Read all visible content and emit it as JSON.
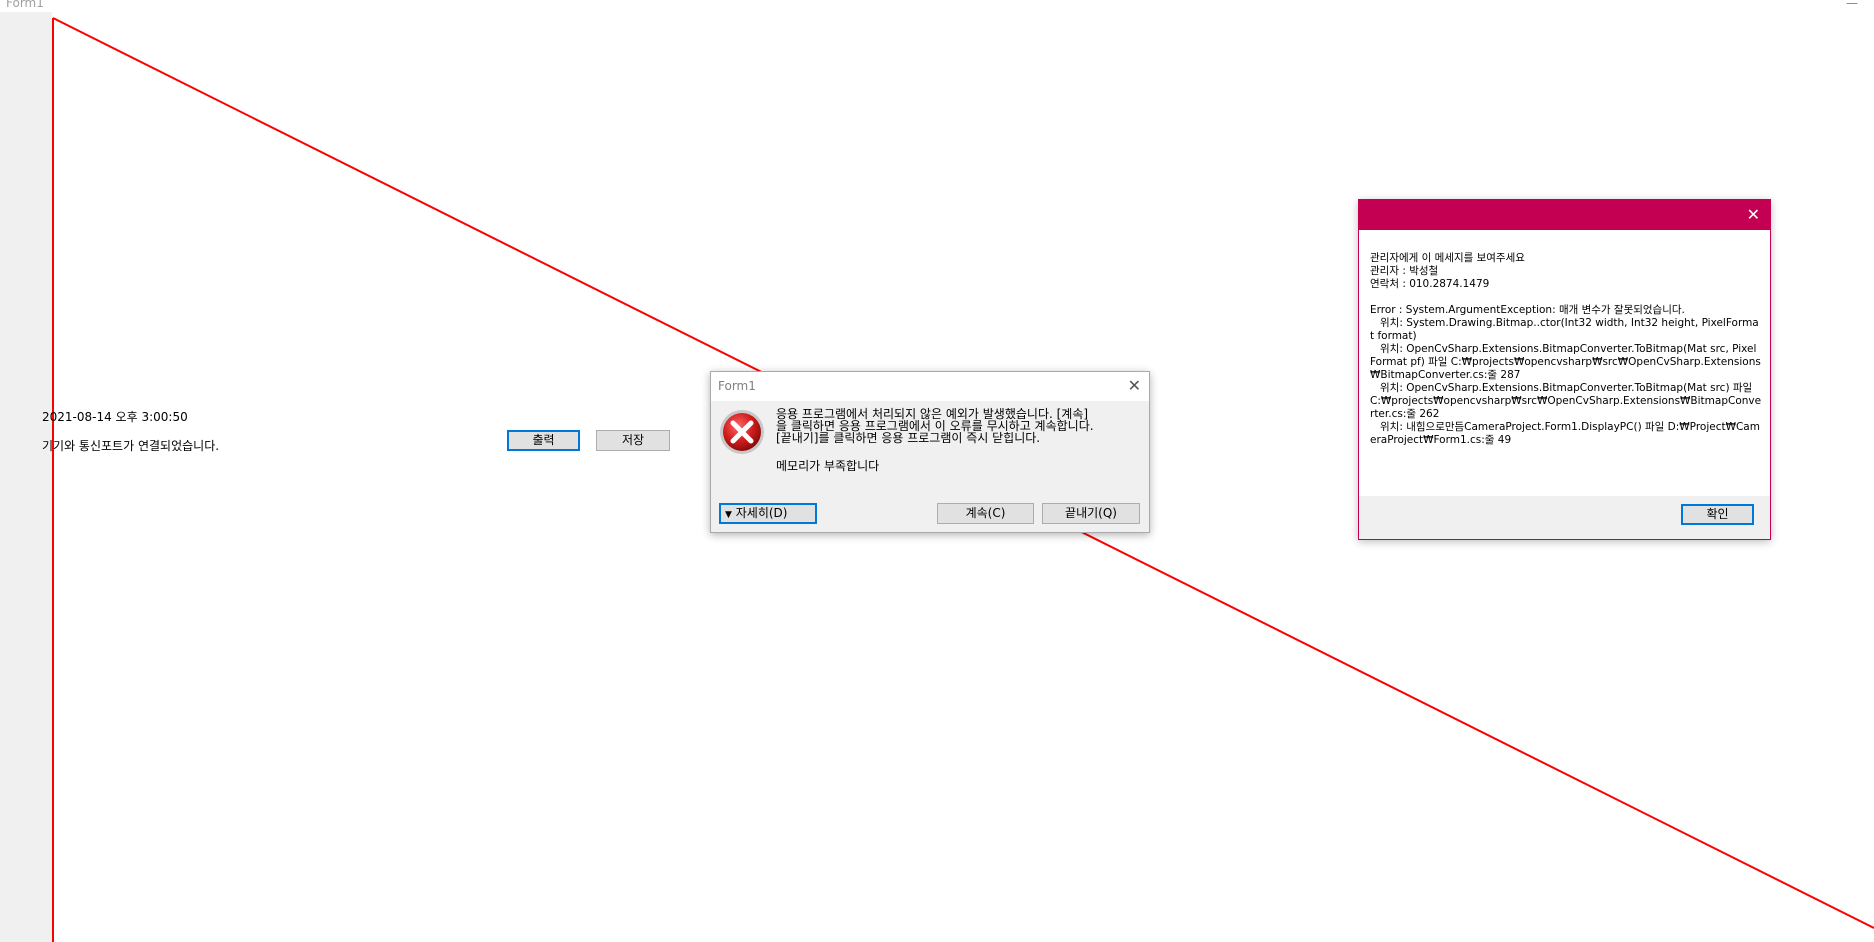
{
  "window": {
    "title": "Form1",
    "minimize_glyph": "—"
  },
  "main": {
    "timestamp": "2021-08-14 오후 3:00:50",
    "status": "기기와 통신포트가 연결되었습니다.",
    "print_label": "출력",
    "save_label": "저장"
  },
  "exception_dialog": {
    "title": "Form1",
    "close_glyph": "✕",
    "icon": "error-icon",
    "message_lines": [
      "응용 프로그램에서 처리되지 않은 예외가 발생했습니다. [계속]",
      "을 클릭하면 응용 프로그램에서 이 오류를 무시하고 계속합니다.",
      "[끝내기]를 클릭하면 응용 프로그램이 즉시 닫힙니다."
    ],
    "detail": "메모리가 부족합니다",
    "details_label": "자세히(D)",
    "continue_label": "계속(C)",
    "quit_label": "끝내기(Q)"
  },
  "admin_dialog": {
    "close_glyph": "✕",
    "lines": [
      "관리자에게 이 메세지를 보여주세요",
      "관리자 : 박성철",
      "연락처 : 010.2874.1479",
      "",
      "Error : System.ArgumentException: 매개 변수가 잘못되었습니다.",
      "   위치: System.Drawing.Bitmap..ctor(Int32 width, Int32 height, PixelFormat format)",
      "   위치: OpenCvSharp.Extensions.BitmapConverter.ToBitmap(Mat src, PixelFormat pf) 파일 C:₩projects₩opencvsharp₩src₩OpenCvSharp.Extensions₩BitmapConverter.cs:줄 287",
      "   위치: OpenCvSharp.Extensions.BitmapConverter.ToBitmap(Mat src) 파일 C:₩projects₩opencvsharp₩src₩OpenCvSharp.Extensions₩BitmapConverter.cs:줄 262",
      "   위치: 내힘으로만듬CameraProject.Form1.DisplayPC() 파일 D:₩Project₩CameraProject₩Form1.cs:줄 49"
    ],
    "ok_label": "확인"
  },
  "colors": {
    "accent": "#0078d7",
    "admin_title": "#c30052",
    "drawn_line": "#ff0000",
    "dialog_bg": "#f0f0f0"
  }
}
